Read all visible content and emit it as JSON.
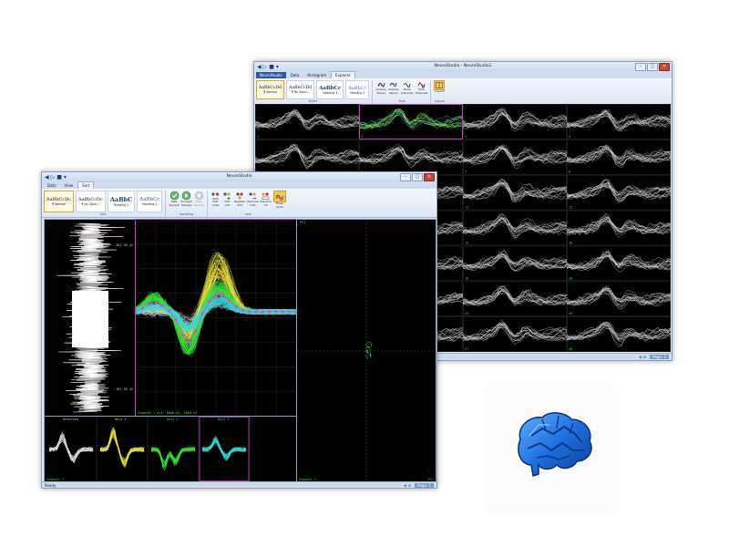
{
  "back_window": {
    "title": "NeuroStudio - NeuroStudio1",
    "qat": [
      "◀",
      "▷",
      "■",
      "▾"
    ],
    "tabs": [
      "NeuroStudio",
      "Data",
      "Histogram",
      "Explorer"
    ],
    "styles": [
      {
        "preview": "AaBbCcDd",
        "name": "¶ Normal"
      },
      {
        "preview": "AaBbCcDd",
        "name": "¶ No Spaci..."
      },
      {
        "preview": "AaBbCc",
        "name": "Heading 1"
      },
      {
        "preview": "AaBbCc",
        "name": "Heading 2"
      }
    ],
    "styles_group_label": "Styles",
    "buttons": [
      {
        "icon": "overlay-traces-icon",
        "label": "Overlay\nTraces"
      },
      {
        "icon": "overlay-stereo-icon",
        "label": "Overlay\nStereo"
      },
      {
        "icon": "show-channels-icon",
        "label": "Show\nChannels"
      },
      {
        "icon": "hide-channels-icon",
        "label": "Hide\nChannels"
      }
    ],
    "view_group_label": "View",
    "layout_button": {
      "icon": "layout-icon",
      "label": "Layout"
    },
    "layout_group_label": "Layout",
    "channel_labels": [
      "1",
      "2",
      "3",
      "4",
      "5",
      "6",
      "7",
      "8",
      "9",
      "10",
      "11",
      "12",
      "13",
      "14",
      "15",
      "16",
      "17",
      "18",
      "19",
      "20",
      "21",
      "22",
      "23",
      "24",
      "25",
      "26",
      "27",
      "28"
    ],
    "status_page": "Page: 1"
  },
  "front_window": {
    "title": "NeuroStudio",
    "qat": [
      "◀",
      "▷",
      "■",
      "▾"
    ],
    "tabs": [
      "Data",
      "View",
      "Sort"
    ],
    "styles": [
      {
        "preview": "AaBbCcDc",
        "name": "¶ Normal"
      },
      {
        "preview": "AaBbCcDc",
        "name": "¶ No Spaci..."
      },
      {
        "preview": "AaBbC",
        "name": "Heading 1"
      },
      {
        "preview": "AaBbCc",
        "name": "Heading 2"
      }
    ],
    "sort_group_label": "Sort",
    "sampling_buttons": [
      {
        "icon": "take-sample-icon",
        "label": "Take\nSample",
        "enabled": true
      },
      {
        "icon": "forward-sample-icon",
        "label": "Forward\nSample",
        "enabled": true
      },
      {
        "icon": "stop-sample-icon",
        "label": "Stop\nSample",
        "enabled": false
      }
    ],
    "sampling_group_label": "Sampling",
    "unit_buttons": [
      {
        "icon": "edit-units-icon",
        "label": "Edit\nUnits"
      },
      {
        "icon": "add-unit-icon",
        "label": "Add\nUnit"
      },
      {
        "icon": "register-unit-icon",
        "label": "Register\nUnit"
      },
      {
        "icon": "remove-unit-icon",
        "label": "Remove\nUnit"
      },
      {
        "icon": "rename-all-icon",
        "label": "Rename\nAll"
      },
      {
        "icon": "show-units-icon",
        "label": "Show\nUnits",
        "active": true
      }
    ],
    "unit_group_label": "Unit",
    "raw_panel": {
      "top_label": "187.50 uV",
      "bottom_label": "-187.50 uV"
    },
    "waveform_panel": {
      "footer": "Channel 1    pt4: 8600 uV, 1800 uS"
    },
    "pca_panel": {
      "corner_label": "PC2",
      "footer": "Channel 1",
      "right_label": "PC1"
    },
    "units": [
      {
        "label": "Unsorted",
        "color": "#d8d8d8"
      },
      {
        "label": "Unit 1",
        "color": "#e8e03a"
      },
      {
        "label": "Unit 2",
        "color": "#35e035"
      },
      {
        "label": "Unit 3",
        "color": "#35d6d6"
      }
    ],
    "units_footer": "Channel 1",
    "status_ready": "Ready",
    "status_page": "Page: 1"
  },
  "colors": {
    "accent_blue": "#2b5aa6",
    "unit_yellow": "#e8e03a",
    "unit_green": "#35e035",
    "unit_cyan": "#35d6d6",
    "unit_magenta": "#e048e0",
    "selection_magenta": "#c040c0"
  },
  "logo": {
    "icon": "brain-icon"
  }
}
